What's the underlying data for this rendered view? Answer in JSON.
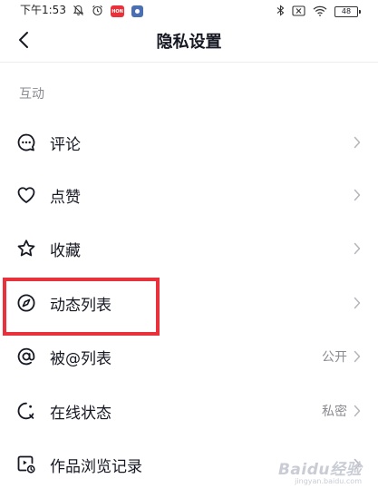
{
  "status_bar": {
    "time": "下午1:53",
    "red_badge_text": "HON",
    "battery": "48"
  },
  "header": {
    "title": "隐私设置"
  },
  "section": {
    "title": "互动"
  },
  "items": [
    {
      "label": "评论",
      "value": "",
      "icon": "comment-icon"
    },
    {
      "label": "点赞",
      "value": "",
      "icon": "heart-icon"
    },
    {
      "label": "收藏",
      "value": "",
      "icon": "star-icon"
    },
    {
      "label": "动态列表",
      "value": "",
      "icon": "compass-icon"
    },
    {
      "label": "被@列表",
      "value": "公开",
      "icon": "at-icon"
    },
    {
      "label": "在线状态",
      "value": "私密",
      "icon": "online-status-icon"
    },
    {
      "label": "作品浏览记录",
      "value": "",
      "icon": "view-history-icon"
    }
  ],
  "watermark": {
    "logo": "Baidu经验",
    "url": "jingyan.baidu.com"
  },
  "colors": {
    "highlight": "#e8313a",
    "text_primary": "#161823",
    "text_secondary": "#8a8b91"
  }
}
